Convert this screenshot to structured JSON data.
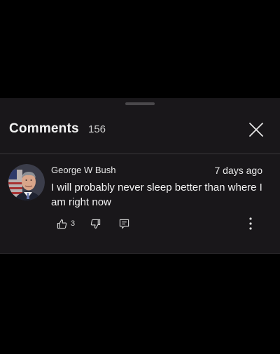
{
  "comments_panel": {
    "title": "Comments",
    "count": "156"
  },
  "comment": {
    "author": "George W Bush",
    "time": "7 days ago",
    "text": "I will probably never sleep better than where I am right now",
    "like_count": "3"
  },
  "icons": {
    "close": "close-icon",
    "like": "thumbs-up-icon",
    "dislike": "thumbs-down-icon",
    "reply": "reply-icon",
    "more": "more-vert-icon"
  }
}
